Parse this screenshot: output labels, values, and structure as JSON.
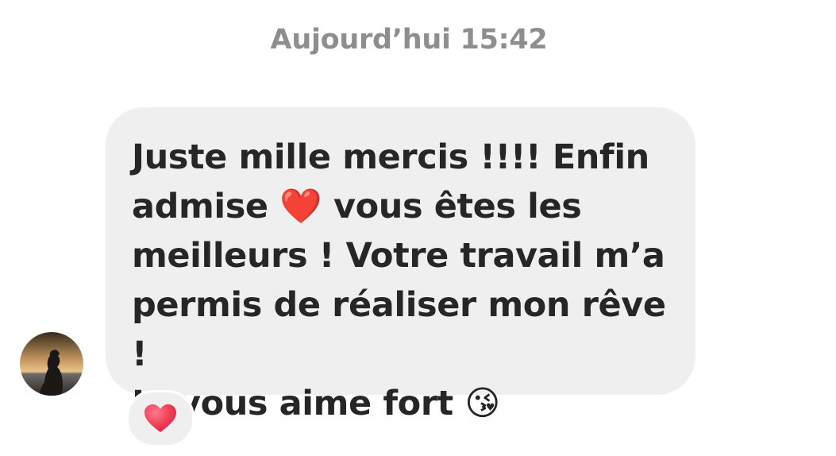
{
  "conversation": {
    "timestamp": "Aujourd’hui 15:42"
  },
  "message": {
    "text": "Juste mille mercis !!!! Enfin\nadmise ❤️ vous êtes les\nmeilleurs ! Votre travail m’a\npermis de réaliser mon rêve !\nJe vous aime fort 😘",
    "sender_avatar": "avatar-photo-sunset-silhouette",
    "reaction": {
      "icon": "red-heart-icon",
      "emoji": "❤️"
    }
  },
  "colors": {
    "bubble_background": "#efefef",
    "text": "#262626",
    "timestamp": "#8e8e8e",
    "heart": "#e8334a"
  }
}
